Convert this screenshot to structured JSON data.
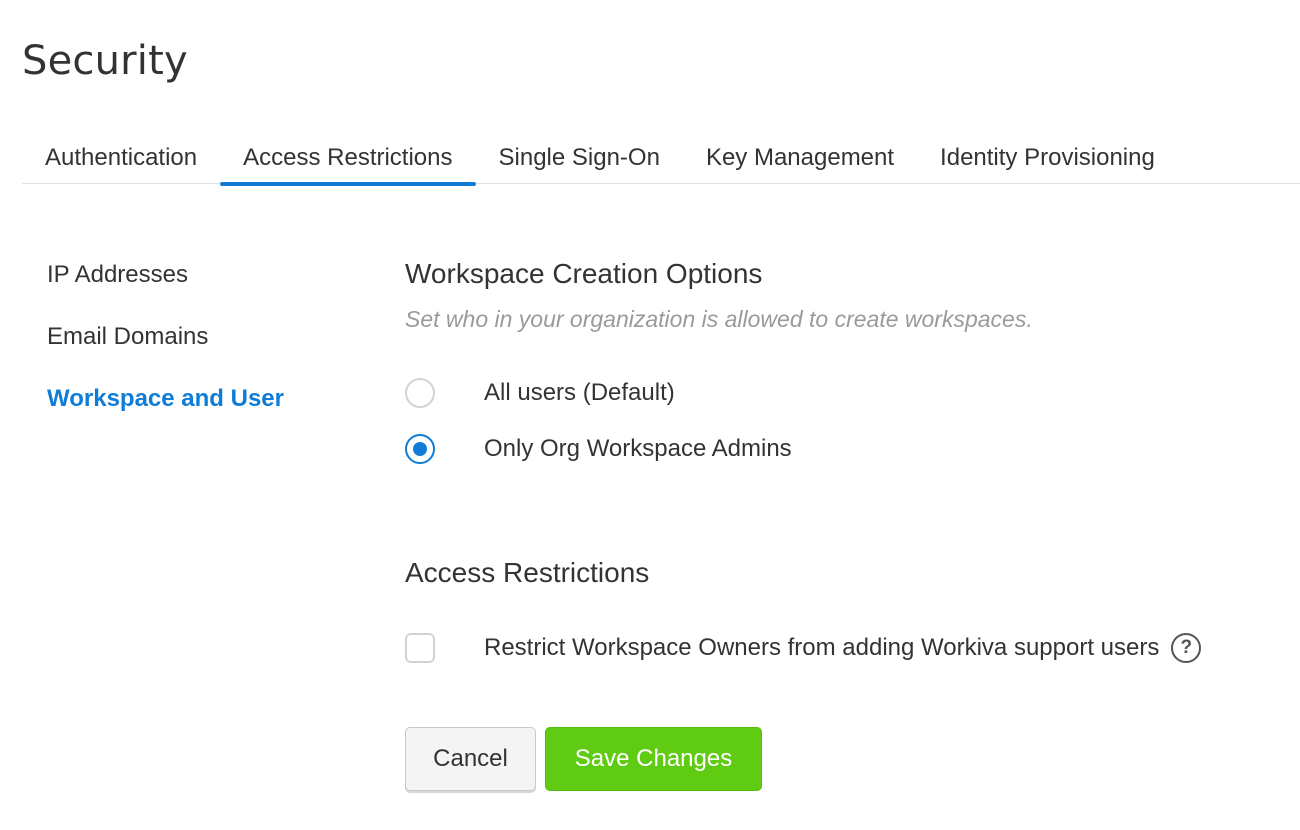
{
  "page": {
    "title": "Security"
  },
  "tabs": [
    {
      "label": "Authentication",
      "active": false
    },
    {
      "label": "Access Restrictions",
      "active": true
    },
    {
      "label": "Single Sign-On",
      "active": false
    },
    {
      "label": "Key Management",
      "active": false
    },
    {
      "label": "Identity Provisioning",
      "active": false
    }
  ],
  "side_nav": {
    "items": [
      {
        "label": "IP Addresses",
        "active": false
      },
      {
        "label": "Email Domains",
        "active": false
      },
      {
        "label": "Workspace and User",
        "active": true
      }
    ]
  },
  "workspace_creation": {
    "title": "Workspace Creation Options",
    "description": "Set who in your organization is allowed to create workspaces.",
    "options": [
      {
        "label": "All users (Default)",
        "selected": false
      },
      {
        "label": "Only Org Workspace Admins",
        "selected": true
      }
    ]
  },
  "access_restrictions": {
    "title": "Access Restrictions",
    "checkbox_label": "Restrict Workspace Owners from adding Workiva support users",
    "checked": false,
    "help_icon": "question-circle-icon",
    "help_glyph": "?"
  },
  "actions": {
    "cancel_label": "Cancel",
    "save_label": "Save Changes"
  },
  "colors": {
    "accent": "#0f7dd7",
    "save_button": "#5fcb12",
    "description_text": "#9a9a9a"
  }
}
